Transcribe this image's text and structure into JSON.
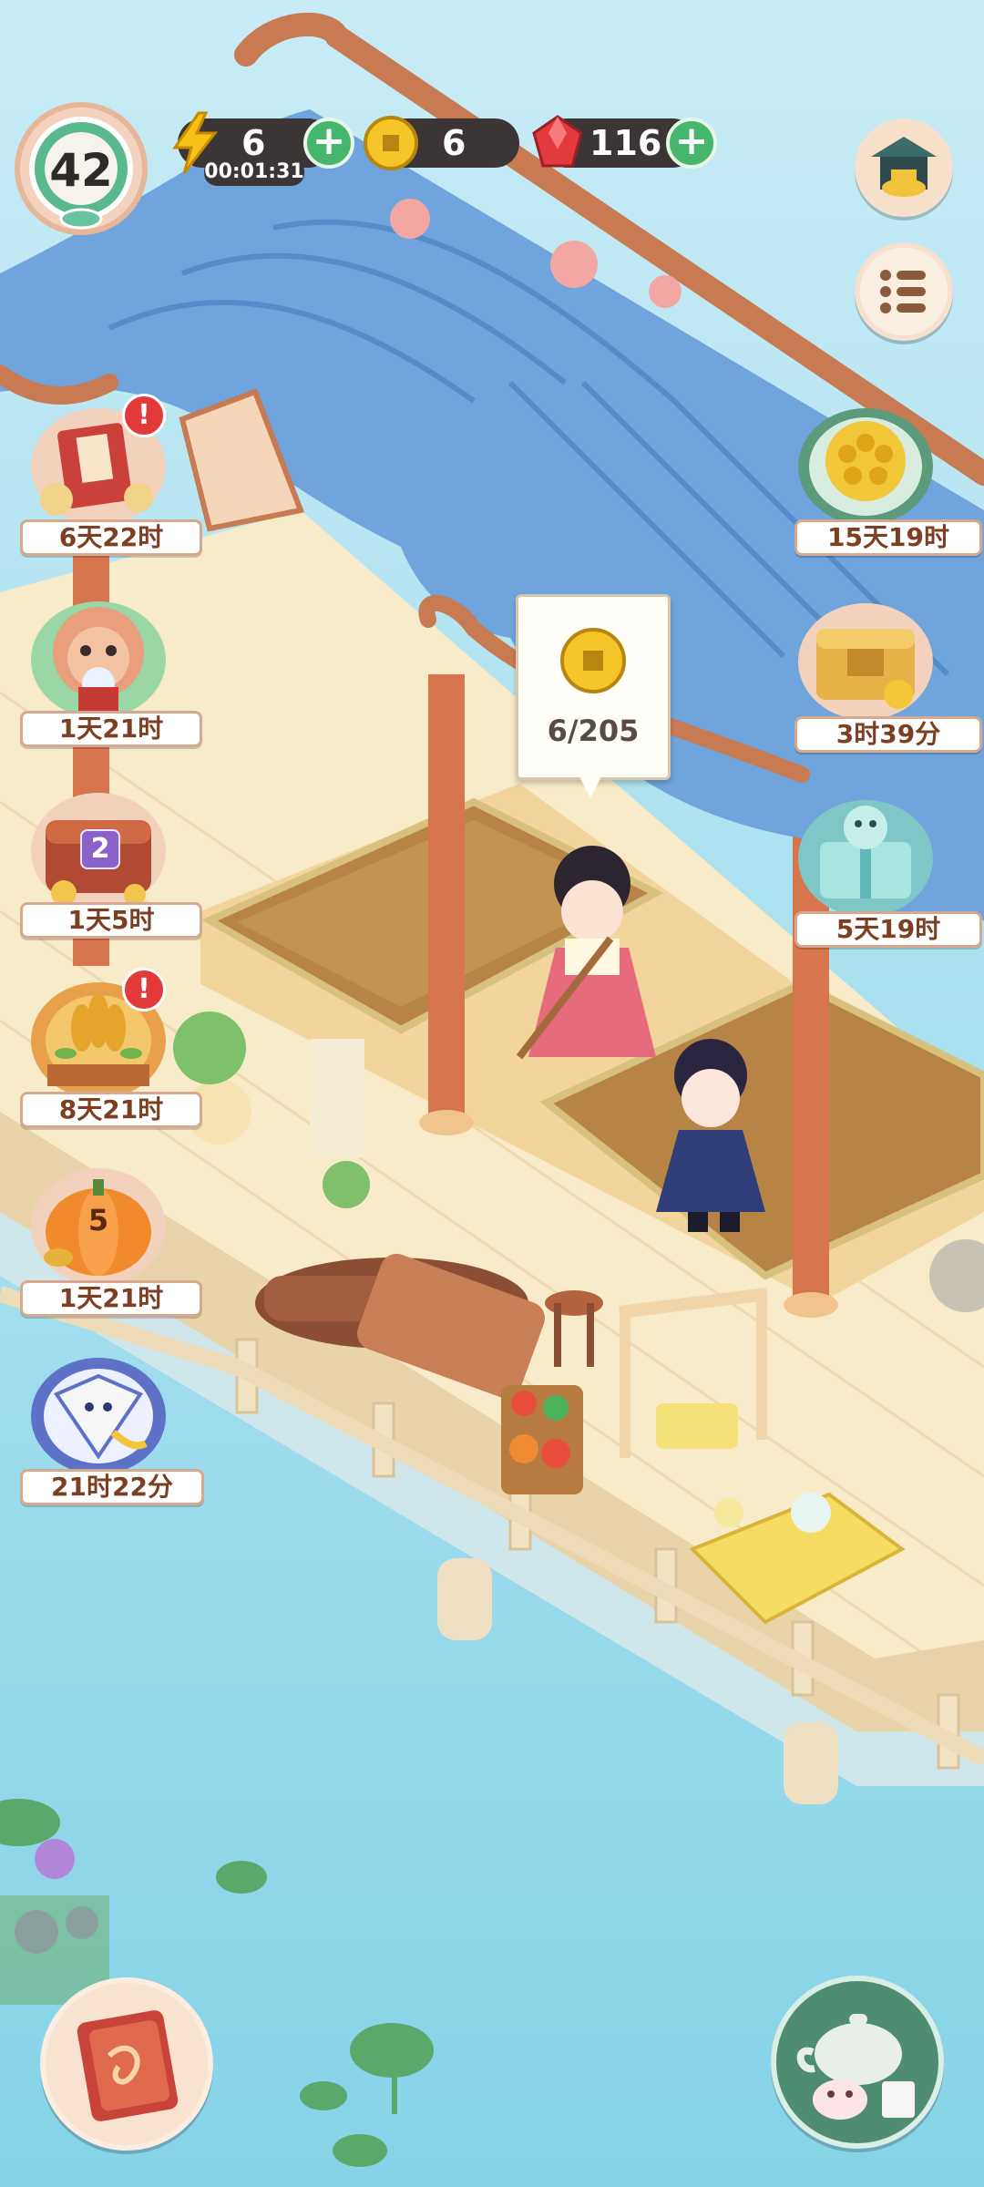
{
  "player": {
    "level": "42"
  },
  "resources": {
    "energy": {
      "value": "6",
      "timer": "00:01:31",
      "icon": "lightning-bolt-icon"
    },
    "coins": {
      "value": "6",
      "icon": "gold-coin-icon"
    },
    "gems": {
      "value": "116",
      "icon": "red-gem-icon"
    }
  },
  "left_events": [
    {
      "name": "imperial-book-event",
      "timer": "6天22时",
      "alert": "!"
    },
    {
      "name": "lion-mascot-event",
      "timer": "1天21时"
    },
    {
      "name": "treasure-chest-event",
      "timer": "1天5时",
      "count": "2"
    },
    {
      "name": "wheat-harvest-event",
      "timer": "8天21时",
      "alert": "!"
    },
    {
      "name": "pumpkin-event",
      "timer": "1天21时",
      "count": "5"
    },
    {
      "name": "kite-event",
      "timer": "21时22分"
    }
  ],
  "right_events": [
    {
      "name": "chrysanthemum-event",
      "timer": "15天19时"
    },
    {
      "name": "golden-box-event",
      "timer": "3时39分"
    },
    {
      "name": "gift-box-event",
      "timer": "5天19时"
    }
  ],
  "coin_bubble": {
    "text": "6/205"
  },
  "colors": {
    "water": "#9fdcec",
    "roof": "#6fa4dd",
    "pillar": "#d7764e",
    "floor": "#f6e5bf",
    "accent": "#46b66c"
  }
}
